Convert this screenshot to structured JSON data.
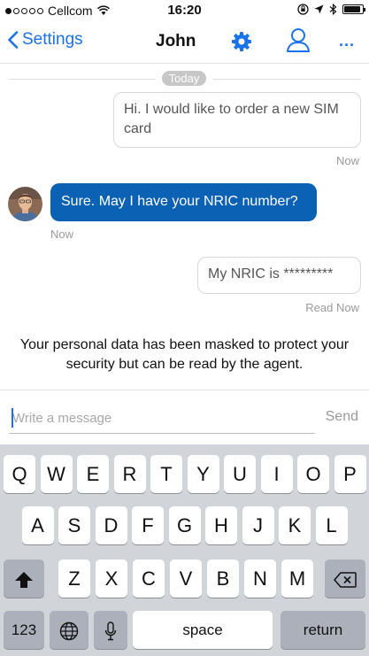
{
  "status_bar": {
    "carrier": "Cellcom",
    "time": "16:20",
    "signal_icon": "signal-dots-icon",
    "wifi_icon": "wifi-icon",
    "battery_icon": "battery-icon",
    "battery_level": 0.9
  },
  "nav": {
    "back_label": "Settings",
    "title": "John",
    "more_label": "..."
  },
  "chat": {
    "date_divider": "Today",
    "messages": [
      {
        "from": "user",
        "text": "Hi. I would like to order a new SIM card",
        "time": "Now"
      },
      {
        "from": "agent",
        "text": "Sure. May I have your NRIC number?",
        "time": "Now"
      },
      {
        "from": "user",
        "text": "My NRIC is *********",
        "read": "Read",
        "time": "Now"
      }
    ],
    "notice": "Your personal data has been masked to protect your security but can be read by the agent."
  },
  "composer": {
    "placeholder": "Write a message",
    "send_label": "Send"
  },
  "keyboard": {
    "row1": [
      "Q",
      "W",
      "E",
      "R",
      "T",
      "Y",
      "U",
      "I",
      "O",
      "P"
    ],
    "row2": [
      "A",
      "S",
      "D",
      "F",
      "G",
      "H",
      "J",
      "K",
      "L"
    ],
    "row3": [
      "Z",
      "X",
      "C",
      "V",
      "B",
      "N",
      "M"
    ],
    "numbers_label": "123",
    "space_label": "space",
    "return_label": "return"
  },
  "colors": {
    "accent": "#1a73e8",
    "agent_bubble": "#0b61b3",
    "keyboard_bg": "#d1d4d9"
  }
}
